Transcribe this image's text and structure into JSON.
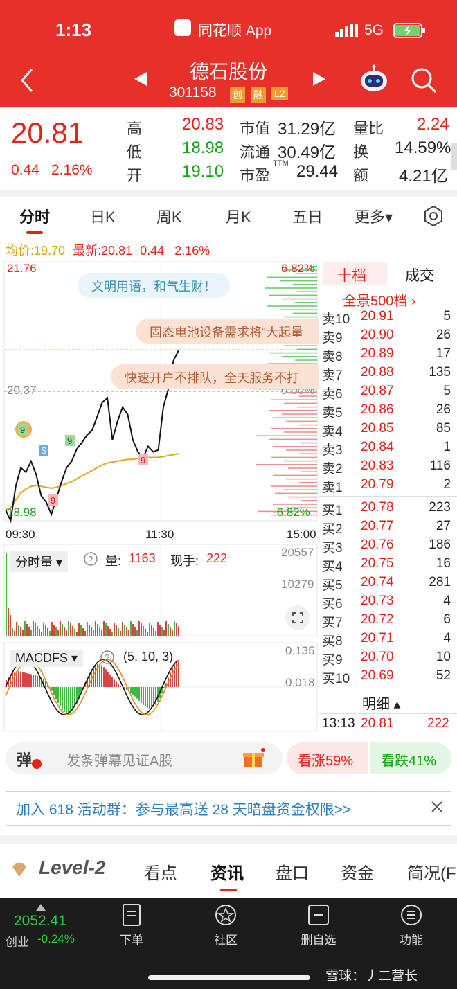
{
  "status": {
    "time": "1:13",
    "app_name": "同花顺 App",
    "network": "5G"
  },
  "header": {
    "title": "德石股份",
    "code": "301158",
    "badges": [
      "创",
      "融",
      "L2"
    ]
  },
  "quote": {
    "price": "20.81",
    "change": "0.44",
    "change_pct": "2.16%",
    "high_label": "高",
    "high": "20.83",
    "low_label": "低",
    "low": "18.98",
    "open_label": "开",
    "open": "19.10",
    "mktcap_label": "市值",
    "mktcap": "31.29亿",
    "float_label": "流通",
    "float": "30.49亿",
    "pe_label": "市盈",
    "pe_sup": "TTM",
    "pe": "29.44",
    "volratio_label": "量比",
    "volratio": "2.24",
    "turnover_label": "换",
    "turnover": "14.59%",
    "amount_label": "额",
    "amount": "4.21亿"
  },
  "tabs": [
    "分时",
    "日K",
    "周K",
    "月K",
    "五日",
    "更多▾"
  ],
  "info_line": {
    "avg_label": "均价:",
    "avg": "19.70",
    "latest_label": "最新:",
    "latest": "20.81",
    "chg": "0.44",
    "pct": "2.16%"
  },
  "chart": {
    "ymax": "21.76",
    "ymid": "20.37",
    "ymin": "18.98",
    "pmax": "6.82%",
    "pmid": "0.00%",
    "pmin": "-6.82%",
    "t_start": "09:30",
    "t_mid": "11:30",
    "t_end": "15:00",
    "bubble1": "文明用语，和气生财！",
    "bubble2": "固态电池设备需求将“大起量",
    "bubble3": "快速开户不排队，全天服务不打",
    "vol_selector": "分时量 ▾",
    "vol_label": "量:",
    "vol_value": "1163",
    "hand_label": "现手:",
    "hand_value": "222",
    "vol_max": "20557",
    "vol_mid": "10279",
    "macd_selector": "MACDFS ▾",
    "macd_params": "(5, 10, 3)",
    "macd_max": "0.135",
    "macd_mid": "0.018"
  },
  "chart_data": {
    "type": "line",
    "price_series": [
      19.1,
      18.98,
      19.35,
      19.55,
      19.5,
      19.62,
      19.48,
      19.25,
      19.18,
      19.05,
      19.22,
      19.4,
      19.55,
      19.62,
      19.75,
      19.82,
      19.9,
      19.95,
      20.1,
      20.25,
      20.3,
      19.85,
      20.05,
      20.2,
      20.12,
      19.85,
      19.72,
      19.65,
      19.78,
      19.72,
      19.74,
      20.2,
      20.4,
      20.7,
      20.81
    ],
    "avg_series": [
      19.1,
      19.12,
      19.2,
      19.28,
      19.32,
      19.35,
      19.36,
      19.35,
      19.34,
      19.33,
      19.34,
      19.36,
      19.38,
      19.4,
      19.43,
      19.46,
      19.49,
      19.52,
      19.55,
      19.58,
      19.6,
      19.61,
      19.62,
      19.63,
      19.64,
      19.64,
      19.65,
      19.65,
      19.66,
      19.66,
      19.66,
      19.67,
      19.68,
      19.69,
      19.7
    ],
    "ylim": [
      18.98,
      21.76
    ]
  },
  "orderbook": {
    "tab_active": "十档",
    "tab_other": "成交",
    "link": "全景500档 ›",
    "asks": [
      {
        "label": "卖10",
        "price": "20.91",
        "vol": "5"
      },
      {
        "label": "卖9",
        "price": "20.90",
        "vol": "26"
      },
      {
        "label": "卖8",
        "price": "20.89",
        "vol": "17"
      },
      {
        "label": "卖7",
        "price": "20.88",
        "vol": "135"
      },
      {
        "label": "卖6",
        "price": "20.87",
        "vol": "5"
      },
      {
        "label": "卖5",
        "price": "20.86",
        "vol": "26"
      },
      {
        "label": "卖4",
        "price": "20.85",
        "vol": "85"
      },
      {
        "label": "卖3",
        "price": "20.84",
        "vol": "1"
      },
      {
        "label": "卖2",
        "price": "20.83",
        "vol": "116"
      },
      {
        "label": "卖1",
        "price": "20.79",
        "vol": "2"
      }
    ],
    "bids": [
      {
        "label": "买1",
        "price": "20.78",
        "vol": "223"
      },
      {
        "label": "买2",
        "price": "20.77",
        "vol": "27"
      },
      {
        "label": "买3",
        "price": "20.76",
        "vol": "186"
      },
      {
        "label": "买4",
        "price": "20.75",
        "vol": "16"
      },
      {
        "label": "买5",
        "price": "20.74",
        "vol": "281"
      },
      {
        "label": "买6",
        "price": "20.73",
        "vol": "4"
      },
      {
        "label": "买7",
        "price": "20.72",
        "vol": "6"
      },
      {
        "label": "买8",
        "price": "20.71",
        "vol": "4"
      },
      {
        "label": "买9",
        "price": "20.70",
        "vol": "10"
      },
      {
        "label": "买10",
        "price": "20.69",
        "vol": "52"
      }
    ],
    "detail_label": "明细 ▴",
    "last_trade": {
      "time": "13:13",
      "price": "20.81",
      "vol": "222"
    }
  },
  "danmu": {
    "icon": "弹",
    "placeholder": "发条弹幕见证A股",
    "up": "看涨59%",
    "down": "看跌41%"
  },
  "promo": {
    "text": "加入 618 活动群：参与最高送 28 天暗盘资金权限>>"
  },
  "subtabs": {
    "level2": "Level-2",
    "items": [
      "看点",
      "资讯",
      "盘口",
      "资金",
      "简况(F"
    ]
  },
  "bottomnav": {
    "index_value": "2052.41",
    "index_name": "创业",
    "index_pct": "-0.24%",
    "items": [
      "下单",
      "社区",
      "删自选",
      "功能"
    ],
    "watermark": "雪球：丿二营长"
  }
}
